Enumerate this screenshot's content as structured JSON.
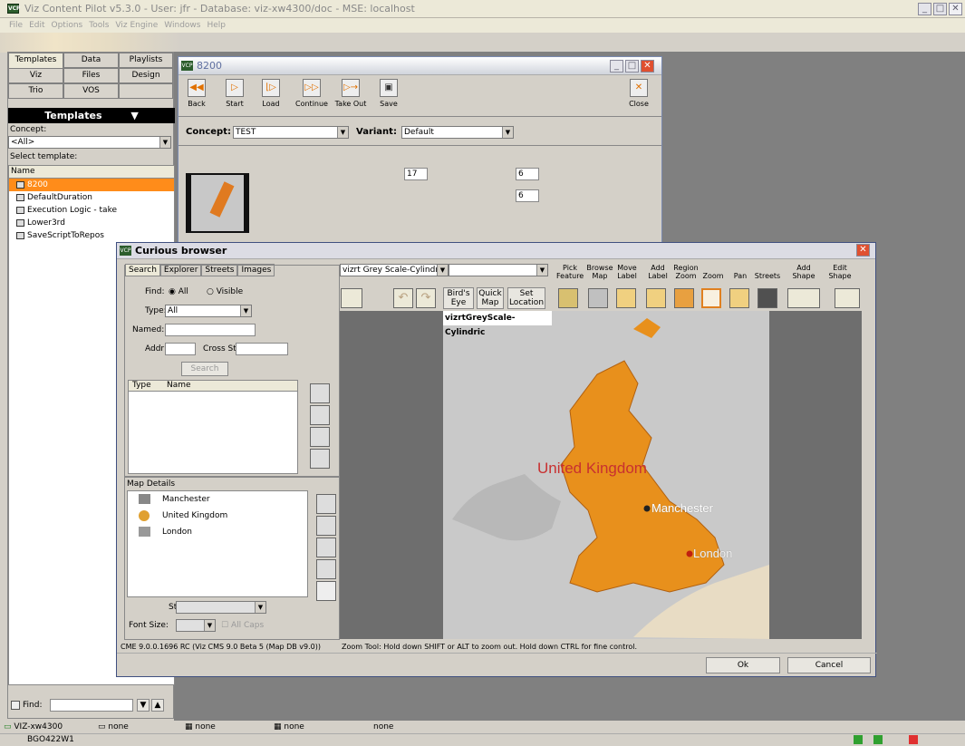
{
  "app": {
    "title": "Viz Content Pilot v5.3.0 - User: jfr - Database: viz-xw4300/doc - MSE: localhost",
    "menu": [
      "File",
      "Edit",
      "Options",
      "Tools",
      "Viz Engine",
      "Windows",
      "Help"
    ]
  },
  "tabs": [
    "Templates",
    "Data",
    "Playlists",
    "Viz",
    "Files",
    "Design",
    "Trio",
    "VOS"
  ],
  "left": {
    "header": "Templates",
    "concept_label": "Concept:",
    "concept_value": "<All>",
    "select_label": "Select template:",
    "col_name": "Name",
    "templates": [
      "8200",
      "DefaultDuration",
      "Execution Logic - take",
      "Lower3rd",
      "SaveScriptToRepos"
    ],
    "find_label": "Find:"
  },
  "w8200": {
    "title": "8200",
    "buttons": [
      "Back",
      "Start",
      "Load",
      "Continue",
      "Take Out",
      "Save",
      "Close"
    ],
    "concept_label": "Concept:",
    "concept_value": "TEST",
    "variant_label": "Variant:",
    "variant_value": "Default",
    "fields": [
      "17",
      "6",
      "6"
    ]
  },
  "curious": {
    "title": "Curious browser",
    "tabs": [
      "Search",
      "Explorer",
      "Streets",
      "Images"
    ],
    "find_label": "Find:",
    "find_all": "All",
    "find_visible": "Visible",
    "type_label": "Type:",
    "type_value": "All",
    "named_label": "Named:",
    "addr_label": "Addr",
    "cross_label": "Cross St",
    "search_btn": "Search",
    "col_type": "Type",
    "col_name": "Name",
    "map_details": "Map Details",
    "details": [
      "Manchester",
      "United Kingdom",
      "London"
    ],
    "style_label": "Style:",
    "font_label": "Font Size:",
    "allcaps": "All Caps",
    "version": "CME 9.0.0.1696 RC (Viz CMS 9.0 Beta 5 (Map DB v9.0))",
    "map_combo": "vizrt Grey Scale-Cylindri",
    "tools": [
      [
        "Pick",
        "Feature"
      ],
      [
        "Browse",
        "Map"
      ],
      [
        "Move",
        "Label"
      ],
      [
        "Add",
        "Label"
      ],
      [
        "Region",
        "Zoom"
      ],
      [
        "Zoom",
        ""
      ],
      [
        "Pan",
        ""
      ],
      [
        "Streets",
        ""
      ],
      [
        "Add",
        "Shape"
      ],
      [
        "Edit",
        "Shape"
      ]
    ],
    "nav": [
      [
        "Bird's",
        "Eye"
      ],
      [
        "Quick",
        "Map"
      ],
      [
        "Set",
        "Location"
      ]
    ],
    "map_name": "vizrtGreyScale-Cylindric",
    "labels": {
      "uk": "United Kingdom",
      "manchester": "Manchester",
      "london": "London"
    },
    "status": "Zoom Tool: Hold down SHIFT or ALT to zoom out. Hold down CTRL for fine control.",
    "ok": "Ok",
    "cancel": "Cancel"
  },
  "statusbar": {
    "host": "VIZ-xw4300",
    "s1": "none",
    "s2": "none",
    "s3": "none",
    "s4": "none",
    "bottom": "BGO422W1"
  }
}
